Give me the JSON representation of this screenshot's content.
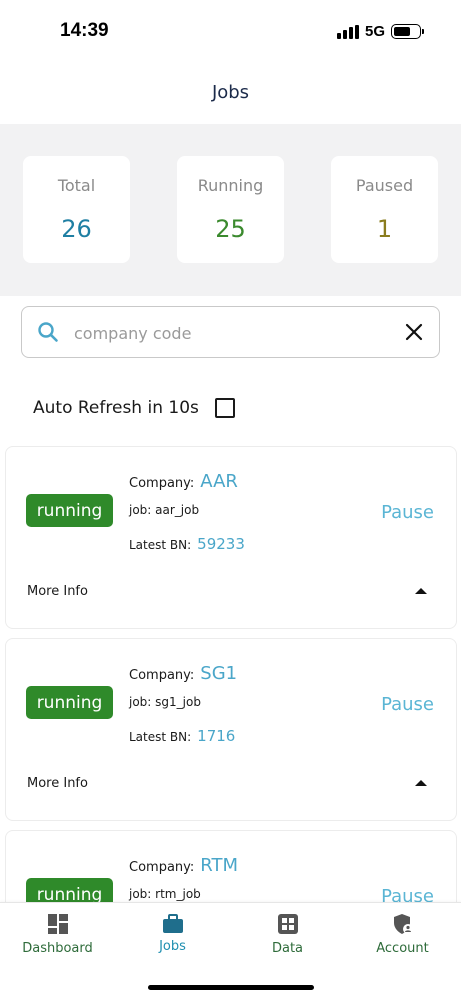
{
  "status_bar": {
    "time": "14:39",
    "network": "5G"
  },
  "header": {
    "title": "Jobs"
  },
  "summary": {
    "total": {
      "label": "Total",
      "value": "26",
      "color": "#1f7fa3"
    },
    "running": {
      "label": "Running",
      "value": "25",
      "color": "#3b8a2e"
    },
    "paused": {
      "label": "Paused",
      "value": "1",
      "color": "#8a7c1e"
    }
  },
  "search": {
    "placeholder": "company code",
    "value": "",
    "icon": "search-icon",
    "clear_icon": "close-icon"
  },
  "auto_refresh": {
    "label": "Auto Refresh in 10s",
    "checked": false
  },
  "jobs": [
    {
      "status": "running",
      "company_label": "Company:",
      "company": "AAR",
      "job_text": "job: aar_job",
      "bn_label": "Latest BN:",
      "bn": "59233",
      "action": "Pause",
      "more_info": "More Info"
    },
    {
      "status": "running",
      "company_label": "Company:",
      "company": "SG1",
      "job_text": "job: sg1_job",
      "bn_label": "Latest BN:",
      "bn": "1716",
      "action": "Pause",
      "more_info": "More Info"
    },
    {
      "status": "running",
      "company_label": "Company:",
      "company": "RTM",
      "job_text": "job: rtm_job",
      "action": "Pause"
    }
  ],
  "tabs": [
    {
      "label": "Dashboard",
      "icon": "dashboard-icon",
      "active": false
    },
    {
      "label": "Jobs",
      "icon": "briefcase-icon",
      "active": true
    },
    {
      "label": "Data",
      "icon": "grid-icon",
      "active": false
    },
    {
      "label": "Account",
      "icon": "shield-user-icon",
      "active": false
    }
  ],
  "colors": {
    "accent": "#4aa6c9",
    "running_badge": "#2f8a2a",
    "tab_label": "#2e6b3a",
    "tab_active": "#1f8fb0"
  }
}
